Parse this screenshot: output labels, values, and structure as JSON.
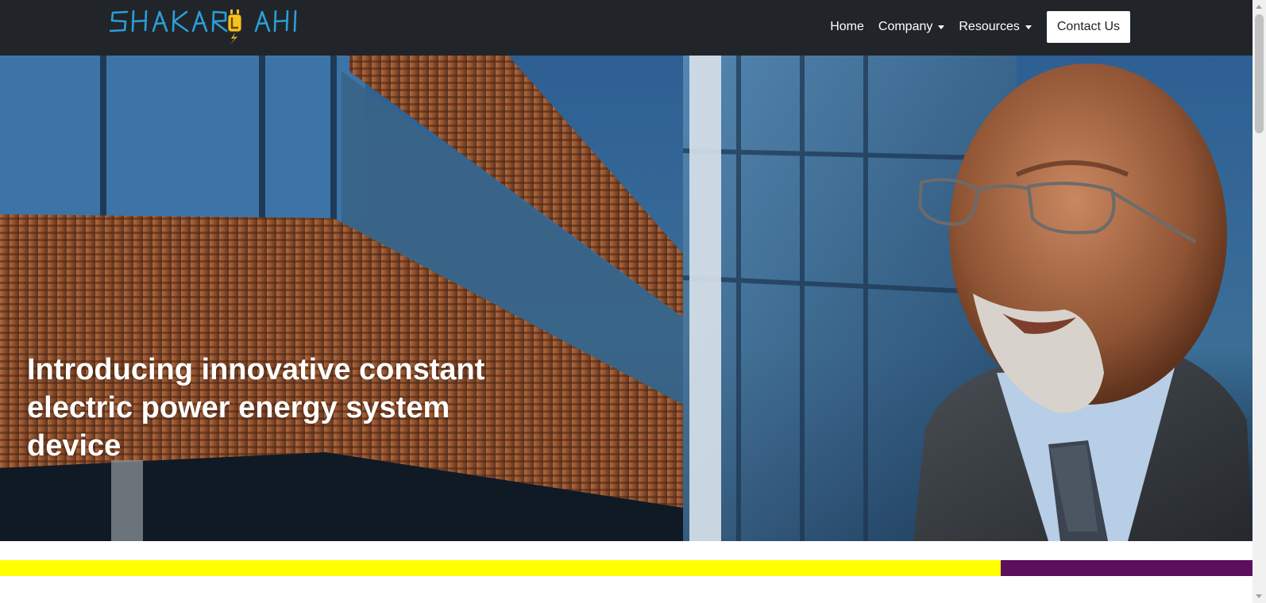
{
  "brand": {
    "logo_text": "SHAKARLAHI",
    "colors": {
      "logo_blue": "#2a9fd8",
      "logo_yellow": "#f5c31e"
    }
  },
  "nav": {
    "home_label": "Home",
    "company_label": "Company",
    "resources_label": "Resources",
    "contact_label": "Contact Us"
  },
  "hero": {
    "title": "Introducing innovative constant electric power energy system device"
  },
  "colors": {
    "navbar": "#212529",
    "accent_yellow": "#ffff00",
    "accent_purple": "#5c0f5c"
  }
}
